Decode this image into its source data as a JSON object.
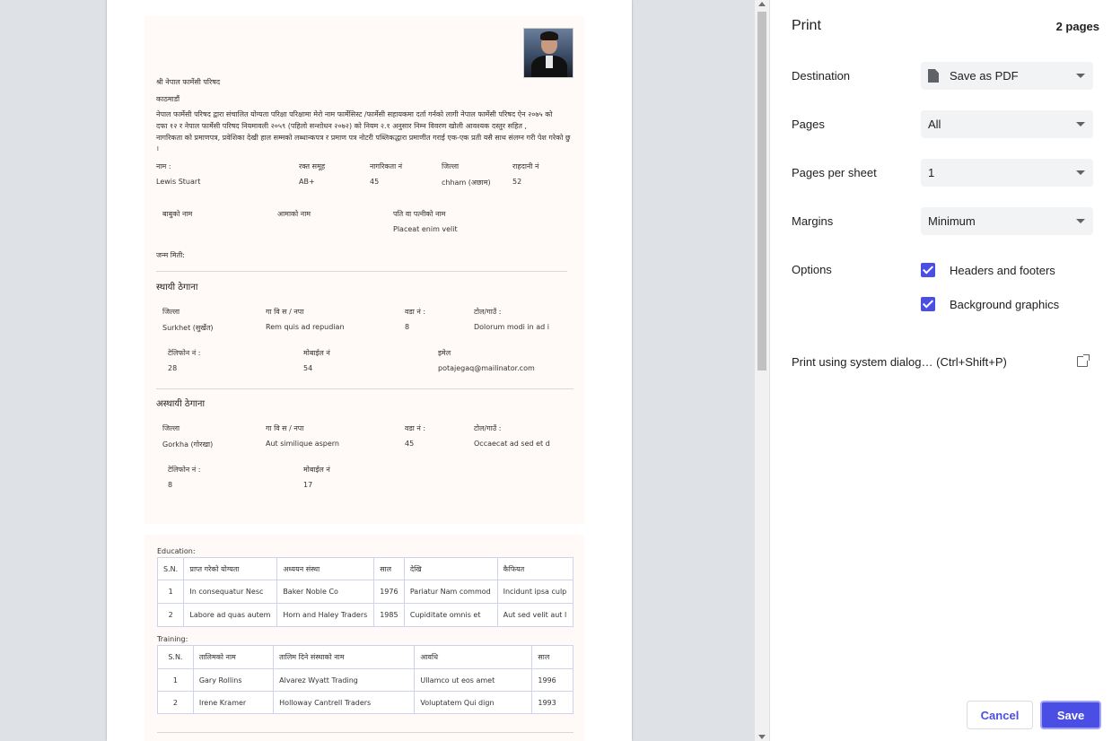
{
  "preview": {
    "header": {
      "addressee": "श्री नेपाल फार्मेसी परिषद",
      "city": "काठमाडौं",
      "body": [
        "नेपाल फार्मेसी परिषद द्वारा संचालित योग्यता परिक्षा परिक्षामा मेरो नाम फार्मेसिस्ट /फार्मेसी सहायकमा दर्ता गर्नको लागी नेपाल फार्मेसी परिषद ऐन २०७५ को",
        "दफा १२ र नेपाल फार्मेसी परिषद नियमावली २०५९ (पहिलो सन्शोधन २०७२) को नियम २.१ अनुसार निम्न विवरण खोली आवश्यक दस्तुर सहित ,",
        "नागरिकता को प्रमाणपत्र, प्रवेशिका देखी हाल सम्मको लब्धान्कपत्र र प्रमाण पत्र नोटरी पब्लिकद्धारा प्रमाणीत गराई एक-एक प्रती यसै साथ संलग्न गरी पेश गरेको छु",
        "।"
      ]
    },
    "personal": {
      "labels": [
        "नाम :",
        "रक्त समूह",
        "नागरिकता नं",
        "जिल्ला",
        "राहदानी नं"
      ],
      "values": [
        "Lewis Stuart",
        "AB+",
        "45",
        "chham (अछाम)",
        "52"
      ]
    },
    "family": {
      "labels": [
        "बाबुको नाम",
        "आमाको नाम",
        "पति वा पत्नीको नाम"
      ],
      "values": [
        "",
        "",
        "Placeat enim velit"
      ]
    },
    "dob_label": "जन्म मिती:",
    "permanent": {
      "title": "स्थायी ठेगाना",
      "labels": [
        "जिल्ला",
        "गा वि स / नपा",
        "वडा नं :",
        "टोल/गाउँ :"
      ],
      "values": [
        "Surkhet (सुर्खेत)",
        "Rem quis ad repudian",
        "8",
        "Dolorum modi in ad i"
      ],
      "contact_labels": [
        "टेलिफोन नं :",
        "मोबाईल नं",
        "इमेल"
      ],
      "contact_values": [
        "28",
        "54",
        "potajegaq@mailinator.com"
      ]
    },
    "temporary": {
      "title": "अस्थायी ठेगाना",
      "labels": [
        "जिल्ला",
        "गा वि स / नपा",
        "वडा नं :",
        "टोल/गाउँ :"
      ],
      "values": [
        "Gorkha (गोरखा)",
        "Aut similique aspern",
        "45",
        "Occaecat ad sed et d"
      ],
      "contact_labels": [
        "टेलिफोन नं :",
        "मोबाईल नं"
      ],
      "contact_values": [
        "8",
        "17"
      ]
    },
    "education": {
      "title": "Education:",
      "headers": [
        "S.N.",
        "प्राप्त गरेको योग्यता",
        "अध्ययन संस्था",
        "साल",
        "देखि",
        "कैफियत"
      ],
      "rows": [
        [
          "1",
          "In consequatur Nesc",
          "Baker Noble Co",
          "1976",
          "Pariatur Nam commod",
          "Incidunt ipsa culp"
        ],
        [
          "2",
          "Labore ad quas autem",
          "Horn and Haley Traders",
          "1985",
          "Cupiditate omnis et",
          "Aut sed velit aut l"
        ]
      ]
    },
    "training": {
      "title": "Training:",
      "headers": [
        "S.N.",
        "तालिमको नाम",
        "तालिम दिने संस्थाको नाम",
        "आवधि",
        "साल"
      ],
      "rows": [
        [
          "1",
          "Gary Rollins",
          "Alvarez Wyatt Trading",
          "Ullamco ut eos amet",
          "1996"
        ],
        [
          "2",
          "Irene Kramer",
          "Holloway Cantrell Traders",
          "Voluptatem Qui dign",
          "1993"
        ]
      ]
    }
  },
  "print": {
    "title": "Print",
    "page_count": "2 pages",
    "destination_label": "Destination",
    "destination_value": "Save as PDF",
    "pages_label": "Pages",
    "pages_value": "All",
    "pps_label": "Pages per sheet",
    "pps_value": "1",
    "margins_label": "Margins",
    "margins_value": "Minimum",
    "options_label": "Options",
    "headers_footers": "Headers and footers",
    "background_graphics": "Background graphics",
    "system_dialog": "Print using system dialog… (Ctrl+Shift+P)",
    "cancel": "Cancel",
    "save": "Save",
    "accent": "#4b4ee5"
  }
}
